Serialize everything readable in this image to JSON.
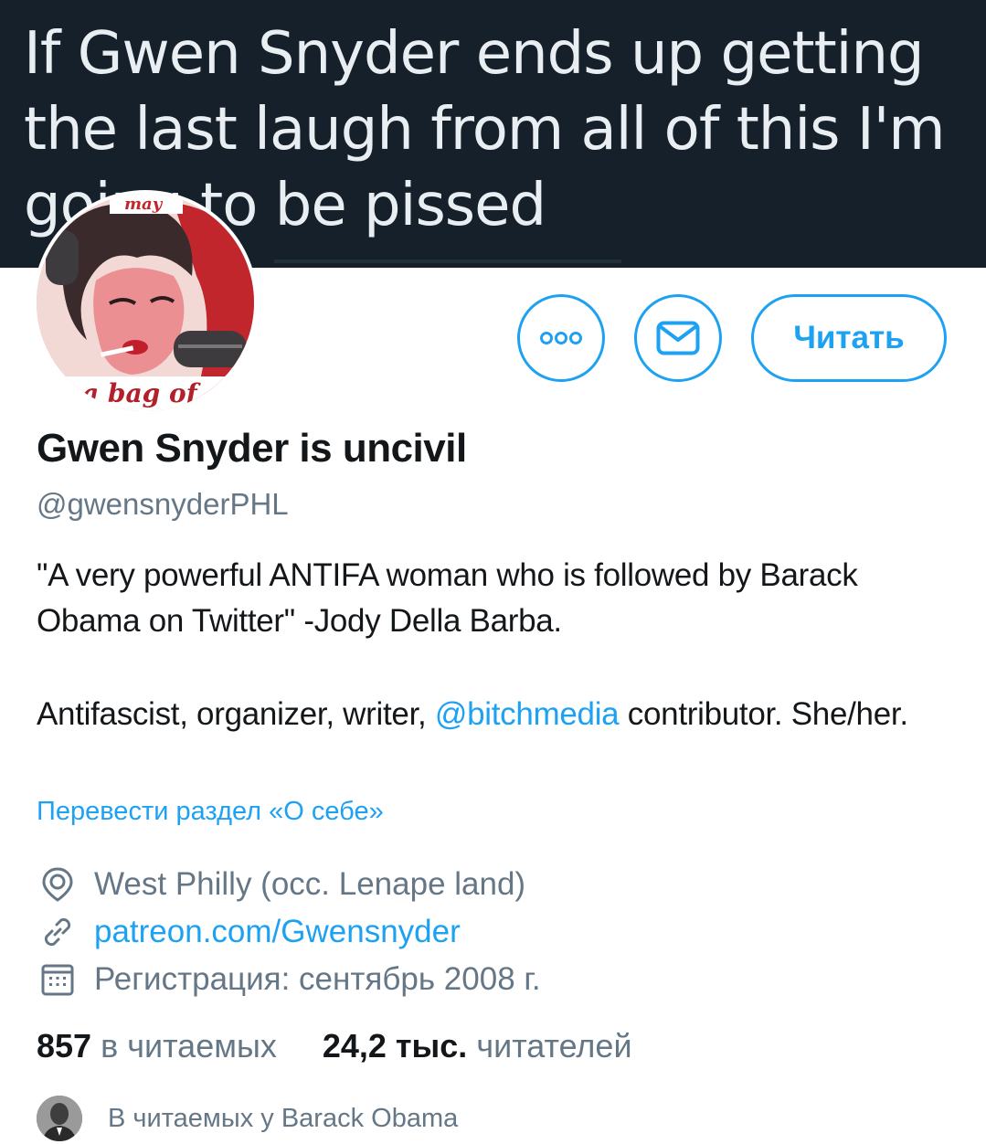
{
  "banner": {
    "text": "If Gwen Snyder ends up getting\nthe last laugh from all of this I'm\ngoing to be pissed"
  },
  "avatar": {
    "caption_top": "may",
    "caption_bottom": "a bag of"
  },
  "actions": {
    "more_icon": "more-icon",
    "mail_icon": "mail-icon",
    "follow_label": "Читать"
  },
  "profile": {
    "name": "Gwen Snyder is uncivil",
    "handle": "@gwensnyderPHL",
    "bio_line1": "\"A very powerful ANTIFA woman who is followed by Barack Obama on Twitter\" -Jody Della Barba.",
    "bio_line2_before": "Antifascist, organizer, writer, ",
    "bio_line2_mention": "@bitchmedia",
    "bio_line2_after": " contributor. She/her.",
    "translate_label": "Перевести раздел «О себе»"
  },
  "meta": {
    "location_icon": "location-icon",
    "location": "West Philly (occ. Lenape land)",
    "link_icon": "link-icon",
    "link": "patreon.com/Gwensnyder",
    "calendar_icon": "calendar-icon",
    "joined": "Регистрация: сентябрь 2008 г."
  },
  "stats": {
    "following_count": "857",
    "following_label": "в читаемых",
    "followers_count": "24,2 тыс.",
    "followers_label": "читателей"
  },
  "followed_by": {
    "text": "В читаемых у Barack Obama"
  },
  "colors": {
    "accent": "#1da1f2",
    "banner_bg": "#15202b",
    "secondary_text": "#657786",
    "primary_text": "#14171a"
  }
}
